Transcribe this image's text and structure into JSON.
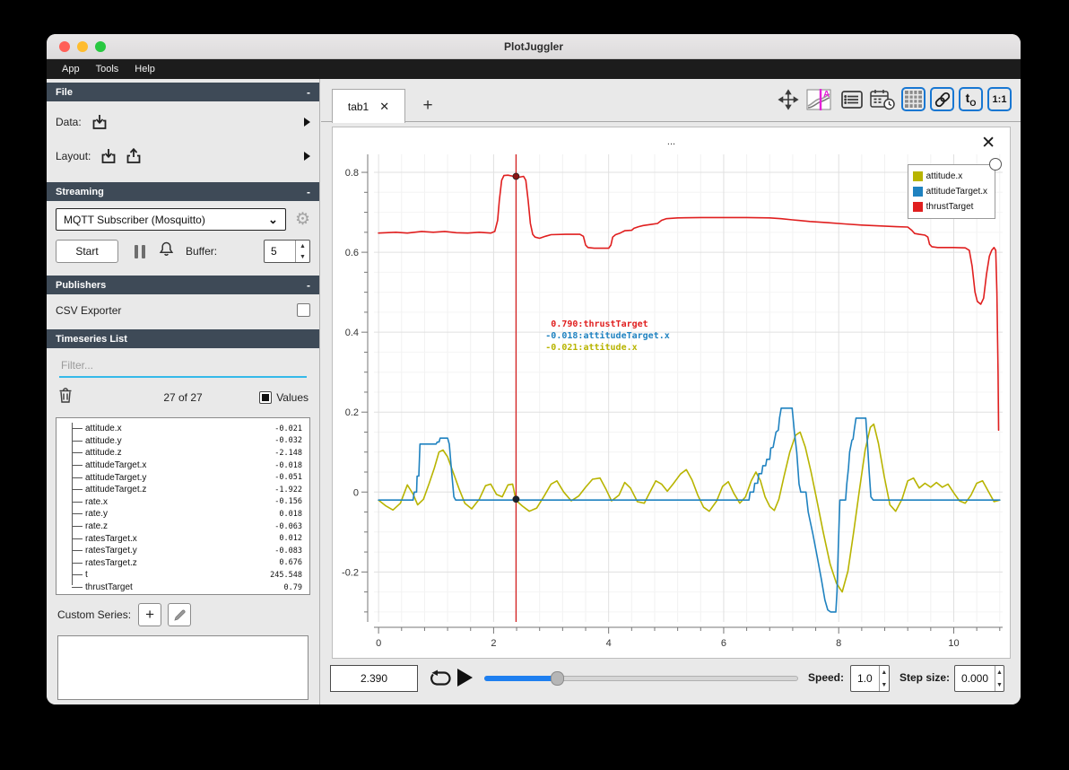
{
  "window": {
    "title": "PlotJuggler"
  },
  "menu": {
    "items": [
      "App",
      "Tools",
      "Help"
    ]
  },
  "left_panel": {
    "file_section": {
      "title": "File",
      "collapse": "-",
      "data_label": "Data:",
      "layout_label": "Layout:"
    },
    "streaming_section": {
      "title": "Streaming",
      "collapse": "-",
      "source": "MQTT Subscriber (Mosquitto)",
      "start_label": "Start",
      "buffer_label": "Buffer:",
      "buffer_value": "5"
    },
    "publishers_section": {
      "title": "Publishers",
      "collapse": "-",
      "csv_exporter_label": "CSV Exporter"
    },
    "timeseries_section": {
      "title": "Timeseries List",
      "filter_placeholder": "Filter...",
      "count": "27 of 27",
      "values_label": "Values",
      "items": [
        {
          "name": "attitude.x",
          "value": "-0.021"
        },
        {
          "name": "attitude.y",
          "value": "-0.032"
        },
        {
          "name": "attitude.z",
          "value": "-2.148"
        },
        {
          "name": "attitudeTarget.x",
          "value": "-0.018"
        },
        {
          "name": "attitudeTarget.y",
          "value": "-0.051"
        },
        {
          "name": "attitudeTarget.z",
          "value": "-1.922"
        },
        {
          "name": "rate.x",
          "value": "-0.156"
        },
        {
          "name": "rate.y",
          "value": "0.018"
        },
        {
          "name": "rate.z",
          "value": "-0.063"
        },
        {
          "name": "ratesTarget.x",
          "value": "0.012"
        },
        {
          "name": "ratesTarget.y",
          "value": "-0.083"
        },
        {
          "name": "ratesTarget.z",
          "value": "0.676"
        },
        {
          "name": "t",
          "value": "245.548"
        },
        {
          "name": "thrustTarget",
          "value": "0.79"
        }
      ],
      "custom_series_label": "Custom Series:"
    }
  },
  "tabs": {
    "active": "tab1",
    "close_glyph": "✕",
    "add_glyph": "+"
  },
  "toolbar": {
    "t0_main": "t",
    "t0_sub": "O",
    "ratio_label": "1:1"
  },
  "plot": {
    "title": "...",
    "close_glyph": "✕",
    "legend": [
      {
        "label": "attitude.x",
        "color": "#b8b400"
      },
      {
        "label": "attitudeTarget.x",
        "color": "#1f82c0"
      },
      {
        "label": "thrustTarget",
        "color": "#e01f1f"
      }
    ],
    "tracker": {
      "x": 2.39,
      "separator": " : ",
      "lines": [
        {
          "value": "0.790",
          "label": "thrustTarget",
          "color": "#e01f1f"
        },
        {
          "value": "-0.018",
          "label": "attitudeTarget.x",
          "color": "#1f82c0"
        },
        {
          "value": "-0.021",
          "label": "attitude.x",
          "color": "#b8b400"
        }
      ],
      "markers": [
        {
          "x": 2.39,
          "y": 0.79,
          "color": "#8b1515"
        },
        {
          "x": 2.39,
          "y": -0.018,
          "color": "#1b2430"
        }
      ]
    }
  },
  "chart_data": {
    "type": "line",
    "title": "...",
    "xlabel": "",
    "ylabel": "",
    "xlim": [
      -0.08,
      10.85
    ],
    "ylim": [
      -0.325,
      0.845
    ],
    "xticks": [
      0,
      2,
      4,
      6,
      8,
      10
    ],
    "yticks": [
      -0.2,
      0,
      0.2,
      0.4,
      0.6,
      0.8
    ],
    "x_minor_step": 0.4,
    "y_minor_step": 0.05,
    "grid": true,
    "legend_position": "top-right",
    "series": [
      {
        "name": "attitude.x",
        "color": "#b8b400",
        "points": [
          [
            0,
            -0.02
          ],
          [
            0.12,
            -0.034
          ],
          [
            0.25,
            -0.045
          ],
          [
            0.38,
            -0.028
          ],
          [
            0.5,
            0.018
          ],
          [
            0.6,
            -0.005
          ],
          [
            0.68,
            -0.032
          ],
          [
            0.78,
            -0.018
          ],
          [
            0.88,
            0.022
          ],
          [
            0.97,
            0.06
          ],
          [
            1.05,
            0.1
          ],
          [
            1.12,
            0.105
          ],
          [
            1.2,
            0.088
          ],
          [
            1.3,
            0.048
          ],
          [
            1.4,
            0.008
          ],
          [
            1.5,
            -0.028
          ],
          [
            1.62,
            -0.042
          ],
          [
            1.75,
            -0.018
          ],
          [
            1.86,
            0.016
          ],
          [
            1.95,
            0.02
          ],
          [
            2.05,
            -0.006
          ],
          [
            2.15,
            -0.012
          ],
          [
            2.25,
            0.018
          ],
          [
            2.33,
            0.02
          ],
          [
            2.39,
            -0.021
          ],
          [
            2.5,
            -0.035
          ],
          [
            2.62,
            -0.048
          ],
          [
            2.75,
            -0.04
          ],
          [
            2.88,
            -0.01
          ],
          [
            3.0,
            0.02
          ],
          [
            3.1,
            0.028
          ],
          [
            3.22,
            0.0
          ],
          [
            3.35,
            -0.022
          ],
          [
            3.48,
            -0.01
          ],
          [
            3.6,
            0.012
          ],
          [
            3.72,
            0.032
          ],
          [
            3.85,
            0.035
          ],
          [
            3.95,
            0.008
          ],
          [
            4.05,
            -0.022
          ],
          [
            4.18,
            -0.008
          ],
          [
            4.28,
            0.024
          ],
          [
            4.38,
            0.01
          ],
          [
            4.5,
            -0.024
          ],
          [
            4.62,
            -0.028
          ],
          [
            4.72,
            0.0
          ],
          [
            4.82,
            0.028
          ],
          [
            4.92,
            0.02
          ],
          [
            5.02,
            0.002
          ],
          [
            5.12,
            0.02
          ],
          [
            5.25,
            0.045
          ],
          [
            5.35,
            0.056
          ],
          [
            5.45,
            0.03
          ],
          [
            5.55,
            -0.008
          ],
          [
            5.65,
            -0.038
          ],
          [
            5.75,
            -0.048
          ],
          [
            5.88,
            -0.022
          ],
          [
            5.98,
            0.014
          ],
          [
            6.08,
            0.026
          ],
          [
            6.18,
            -0.004
          ],
          [
            6.28,
            -0.028
          ],
          [
            6.38,
            -0.012
          ],
          [
            6.48,
            0.028
          ],
          [
            6.56,
            0.05
          ],
          [
            6.64,
            0.028
          ],
          [
            6.72,
            -0.012
          ],
          [
            6.8,
            -0.036
          ],
          [
            6.88,
            -0.046
          ],
          [
            6.96,
            -0.018
          ],
          [
            7.05,
            0.04
          ],
          [
            7.15,
            0.1
          ],
          [
            7.25,
            0.142
          ],
          [
            7.33,
            0.15
          ],
          [
            7.42,
            0.112
          ],
          [
            7.52,
            0.05
          ],
          [
            7.62,
            -0.02
          ],
          [
            7.73,
            -0.1
          ],
          [
            7.85,
            -0.18
          ],
          [
            7.96,
            -0.228
          ],
          [
            8.06,
            -0.25
          ],
          [
            8.16,
            -0.198
          ],
          [
            8.26,
            -0.1
          ],
          [
            8.36,
            0.005
          ],
          [
            8.46,
            0.105
          ],
          [
            8.55,
            0.162
          ],
          [
            8.61,
            0.17
          ],
          [
            8.69,
            0.122
          ],
          [
            8.79,
            0.04
          ],
          [
            8.89,
            -0.032
          ],
          [
            8.99,
            -0.048
          ],
          [
            9.1,
            -0.018
          ],
          [
            9.2,
            0.028
          ],
          [
            9.3,
            0.035
          ],
          [
            9.4,
            0.01
          ],
          [
            9.5,
            0.022
          ],
          [
            9.6,
            0.012
          ],
          [
            9.7,
            0.024
          ],
          [
            9.8,
            0.012
          ],
          [
            9.9,
            0.02
          ],
          [
            10.0,
            -0.002
          ],
          [
            10.1,
            -0.022
          ],
          [
            10.2,
            -0.028
          ],
          [
            10.3,
            -0.008
          ],
          [
            10.4,
            0.022
          ],
          [
            10.5,
            0.028
          ],
          [
            10.6,
            0.002
          ],
          [
            10.7,
            -0.024
          ],
          [
            10.8,
            -0.02
          ]
        ]
      },
      {
        "name": "attitudeTarget.x",
        "color": "#1f82c0",
        "points": [
          [
            0,
            -0.02
          ],
          [
            0.6,
            -0.02
          ],
          [
            0.62,
            0.0
          ],
          [
            0.66,
            0.0
          ],
          [
            0.67,
            0.04
          ],
          [
            0.7,
            0.04
          ],
          [
            0.72,
            0.12
          ],
          [
            1.0,
            0.12
          ],
          [
            1.02,
            0.125
          ],
          [
            1.05,
            0.125
          ],
          [
            1.07,
            0.135
          ],
          [
            1.2,
            0.135
          ],
          [
            1.23,
            0.12
          ],
          [
            1.27,
            0.05
          ],
          [
            1.31,
            -0.012
          ],
          [
            1.34,
            -0.02
          ],
          [
            6.44,
            -0.02
          ],
          [
            6.46,
            0.0
          ],
          [
            6.52,
            0.0
          ],
          [
            6.54,
            0.022
          ],
          [
            6.59,
            0.022
          ],
          [
            6.61,
            0.046
          ],
          [
            6.66,
            0.046
          ],
          [
            6.68,
            0.066
          ],
          [
            6.73,
            0.066
          ],
          [
            6.75,
            0.082
          ],
          [
            6.8,
            0.082
          ],
          [
            6.82,
            0.11
          ],
          [
            6.86,
            0.112
          ],
          [
            6.88,
            0.128
          ],
          [
            6.91,
            0.15
          ],
          [
            6.95,
            0.155
          ],
          [
            6.97,
            0.185
          ],
          [
            7.0,
            0.21
          ],
          [
            7.19,
            0.21
          ],
          [
            7.23,
            0.15
          ],
          [
            7.27,
            0.1
          ],
          [
            7.31,
            0.02
          ],
          [
            7.34,
            0.0
          ],
          [
            7.43,
            0.0
          ],
          [
            7.47,
            -0.05
          ],
          [
            7.55,
            -0.105
          ],
          [
            7.63,
            -0.165
          ],
          [
            7.7,
            -0.22
          ],
          [
            7.76,
            -0.27
          ],
          [
            7.81,
            -0.295
          ],
          [
            7.86,
            -0.3
          ],
          [
            7.95,
            -0.3
          ],
          [
            7.97,
            -0.25
          ],
          [
            7.99,
            -0.15
          ],
          [
            8.02,
            -0.02
          ],
          [
            8.12,
            -0.02
          ],
          [
            8.14,
            0.02
          ],
          [
            8.17,
            0.06
          ],
          [
            8.19,
            0.1
          ],
          [
            8.23,
            0.13
          ],
          [
            8.25,
            0.132
          ],
          [
            8.27,
            0.155
          ],
          [
            8.3,
            0.185
          ],
          [
            8.47,
            0.185
          ],
          [
            8.5,
            0.12
          ],
          [
            8.53,
            0.05
          ],
          [
            8.56,
            -0.012
          ],
          [
            8.6,
            -0.02
          ],
          [
            10.8,
            -0.02
          ]
        ]
      },
      {
        "name": "thrustTarget",
        "color": "#e01f1f",
        "points": [
          [
            0,
            0.648
          ],
          [
            0.3,
            0.65
          ],
          [
            0.5,
            0.648
          ],
          [
            0.75,
            0.652
          ],
          [
            0.95,
            0.65
          ],
          [
            1.15,
            0.652
          ],
          [
            1.35,
            0.649
          ],
          [
            1.55,
            0.648
          ],
          [
            1.75,
            0.65
          ],
          [
            1.95,
            0.648
          ],
          [
            2.02,
            0.652
          ],
          [
            2.07,
            0.68
          ],
          [
            2.1,
            0.73
          ],
          [
            2.14,
            0.78
          ],
          [
            2.18,
            0.792
          ],
          [
            2.25,
            0.793
          ],
          [
            2.35,
            0.79
          ],
          [
            2.45,
            0.788
          ],
          [
            2.52,
            0.79
          ],
          [
            2.56,
            0.78
          ],
          [
            2.6,
            0.73
          ],
          [
            2.64,
            0.672
          ],
          [
            2.68,
            0.645
          ],
          [
            2.72,
            0.638
          ],
          [
            2.8,
            0.635
          ],
          [
            2.9,
            0.64
          ],
          [
            3.0,
            0.644
          ],
          [
            3.25,
            0.645
          ],
          [
            3.5,
            0.645
          ],
          [
            3.56,
            0.64
          ],
          [
            3.6,
            0.618
          ],
          [
            3.64,
            0.612
          ],
          [
            3.75,
            0.61
          ],
          [
            4.0,
            0.61
          ],
          [
            4.04,
            0.618
          ],
          [
            4.07,
            0.638
          ],
          [
            4.12,
            0.644
          ],
          [
            4.2,
            0.648
          ],
          [
            4.28,
            0.654
          ],
          [
            4.4,
            0.655
          ],
          [
            4.44,
            0.66
          ],
          [
            4.52,
            0.664
          ],
          [
            4.6,
            0.667
          ],
          [
            4.75,
            0.67
          ],
          [
            4.85,
            0.672
          ],
          [
            4.92,
            0.68
          ],
          [
            5.0,
            0.684
          ],
          [
            5.2,
            0.686
          ],
          [
            5.6,
            0.687
          ],
          [
            6.0,
            0.687
          ],
          [
            6.4,
            0.687
          ],
          [
            6.8,
            0.686
          ],
          [
            7.0,
            0.684
          ],
          [
            7.2,
            0.681
          ],
          [
            7.5,
            0.677
          ],
          [
            7.8,
            0.674
          ],
          [
            8.1,
            0.671
          ],
          [
            8.4,
            0.668
          ],
          [
            8.7,
            0.666
          ],
          [
            9.0,
            0.664
          ],
          [
            9.2,
            0.663
          ],
          [
            9.27,
            0.655
          ],
          [
            9.32,
            0.647
          ],
          [
            9.4,
            0.645
          ],
          [
            9.5,
            0.643
          ],
          [
            9.55,
            0.638
          ],
          [
            9.58,
            0.62
          ],
          [
            9.62,
            0.614
          ],
          [
            9.72,
            0.612
          ],
          [
            10.0,
            0.612
          ],
          [
            10.2,
            0.611
          ],
          [
            10.27,
            0.605
          ],
          [
            10.32,
            0.565
          ],
          [
            10.37,
            0.5
          ],
          [
            10.41,
            0.477
          ],
          [
            10.47,
            0.47
          ],
          [
            10.52,
            0.485
          ],
          [
            10.57,
            0.545
          ],
          [
            10.62,
            0.59
          ],
          [
            10.66,
            0.605
          ],
          [
            10.7,
            0.612
          ],
          [
            10.73,
            0.605
          ],
          [
            10.75,
            0.5
          ],
          [
            10.77,
            0.3
          ],
          [
            10.78,
            0.155
          ]
        ]
      }
    ]
  },
  "playback": {
    "time": "2.390",
    "progress": 0.23,
    "speed_label": "Speed:",
    "speed_value": "1.0",
    "step_label": "Step size:",
    "step_value": "0.000"
  }
}
